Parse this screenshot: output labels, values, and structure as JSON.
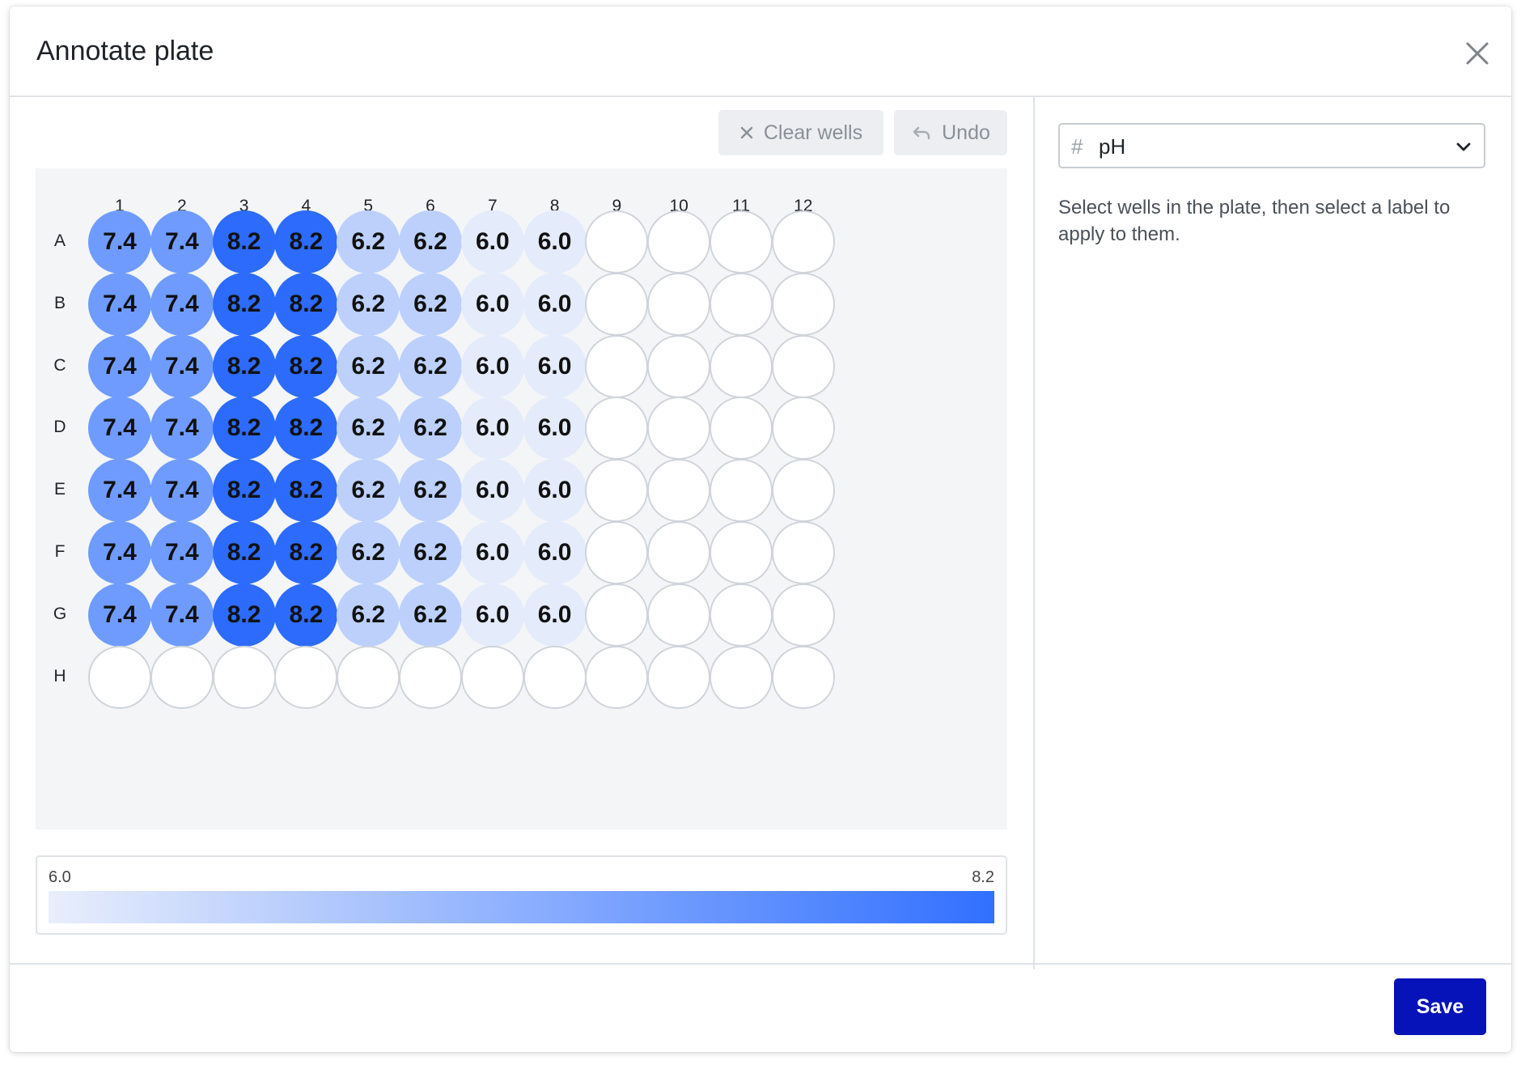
{
  "dialog": {
    "title": "Annotate plate"
  },
  "toolbar": {
    "clear_label": "Clear wells",
    "undo_label": "Undo"
  },
  "plate": {
    "columns": [
      "1",
      "2",
      "3",
      "4",
      "5",
      "6",
      "7",
      "8",
      "9",
      "10",
      "11",
      "12"
    ],
    "rows": [
      "A",
      "B",
      "C",
      "D",
      "E",
      "F",
      "G",
      "H"
    ],
    "wells": [
      [
        "7.4",
        "7.4",
        "8.2",
        "8.2",
        "6.2",
        "6.2",
        "6.0",
        "6.0",
        "",
        "",
        "",
        ""
      ],
      [
        "7.4",
        "7.4",
        "8.2",
        "8.2",
        "6.2",
        "6.2",
        "6.0",
        "6.0",
        "",
        "",
        "",
        ""
      ],
      [
        "7.4",
        "7.4",
        "8.2",
        "8.2",
        "6.2",
        "6.2",
        "6.0",
        "6.0",
        "",
        "",
        "",
        ""
      ],
      [
        "7.4",
        "7.4",
        "8.2",
        "8.2",
        "6.2",
        "6.2",
        "6.0",
        "6.0",
        "",
        "",
        "",
        ""
      ],
      [
        "7.4",
        "7.4",
        "8.2",
        "8.2",
        "6.2",
        "6.2",
        "6.0",
        "6.0",
        "",
        "",
        "",
        ""
      ],
      [
        "7.4",
        "7.4",
        "8.2",
        "8.2",
        "6.2",
        "6.2",
        "6.0",
        "6.0",
        "",
        "",
        "",
        ""
      ],
      [
        "7.4",
        "7.4",
        "8.2",
        "8.2",
        "6.2",
        "6.2",
        "6.0",
        "6.0",
        "",
        "",
        "",
        ""
      ],
      [
        "",
        "",
        "",
        "",
        "",
        "",
        "",
        "",
        "",
        "",
        "",
        ""
      ]
    ]
  },
  "legend": {
    "min": "6.0",
    "max": "8.2",
    "color_low": "#e8eefc",
    "color_high": "#3170ff"
  },
  "well_colors": {
    "6.0": "#e4ebfb",
    "6.2": "#bcd0fb",
    "7.4": "#6f9bff",
    "8.2": "#2c6bfb"
  },
  "label_select": {
    "icon": "hash-icon",
    "value": "pH"
  },
  "help_text": "Select wells in the plate, then select a label to apply to them.",
  "footer": {
    "save_label": "Save"
  },
  "colors": {
    "save_button": "#0513b8"
  }
}
